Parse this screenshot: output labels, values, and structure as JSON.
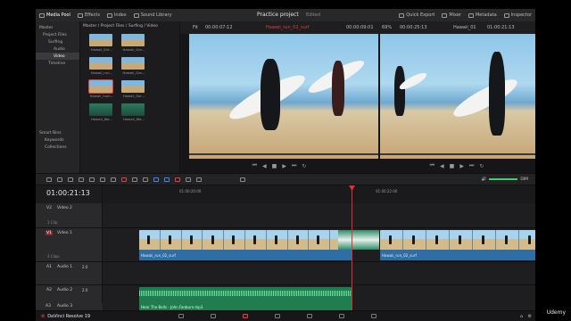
{
  "app": {
    "project_title": "Practice project",
    "project_status": "Edited",
    "brand": "DaVinci Resolve 19"
  },
  "topbar": {
    "left_items": [
      {
        "label": "Media Pool",
        "icon": "media-pool-icon",
        "active": true
      },
      {
        "label": "Effects",
        "icon": "effects-icon",
        "active": false
      },
      {
        "label": "Index",
        "icon": "index-icon",
        "active": false
      },
      {
        "label": "Sound Library",
        "icon": "sound-library-icon",
        "active": false
      }
    ],
    "right_items": [
      {
        "label": "Quick Export",
        "icon": "quick-export-icon"
      },
      {
        "label": "Mixer",
        "icon": "mixer-icon"
      },
      {
        "label": "Metadata",
        "icon": "metadata-icon"
      },
      {
        "label": "Inspector",
        "icon": "inspector-icon"
      }
    ]
  },
  "media_pool": {
    "tree": [
      {
        "label": "Master",
        "selected": false
      },
      {
        "label": "Project Files",
        "selected": false
      },
      {
        "label": "Surfing",
        "selected": false
      },
      {
        "label": "Audio",
        "selected": false
      },
      {
        "label": "Video",
        "selected": true
      },
      {
        "label": "Timeline",
        "selected": false
      }
    ],
    "smart_bins_title": "Smart Bins",
    "smart_bins": [
      "Keywords",
      "Collections"
    ],
    "path": "Master / Project Files / Surfing / Video",
    "clips": [
      "Hawaii_Ent...",
      "Hawaii_Gre...",
      "Hawaii_run...",
      "Hawaii_Gre...",
      "Hawaii_hum...",
      "Hawaii_Sur...",
      "Hawaii_Wa...",
      "Hawaii_Wa..."
    ]
  },
  "source_viewer": {
    "zoom": "Fit",
    "timecode_left": "00:00:07:12",
    "clip_name": "Hawaii_run_02_surf",
    "timecode_right": "00:00:09:01"
  },
  "timeline_viewer": {
    "zoom": "69%",
    "timecode_left": "00:00:25:13",
    "timeline_name": "Hawaii_01",
    "timecode_right": "01:00:21:13"
  },
  "timeline": {
    "current_timecode": "01:00:21:13",
    "ruler_labels": [
      "01:00:20:00",
      "01:00:22:00"
    ],
    "volume_label": "DIM",
    "tracks": [
      {
        "id": "V2",
        "name": "Video 2",
        "sub": "1 Clip"
      },
      {
        "id": "V1",
        "name": "Video 1",
        "sub": "3 Clips"
      },
      {
        "id": "A1",
        "name": "Audio 1",
        "level": "2.0"
      },
      {
        "id": "A2",
        "name": "Audio 2",
        "level": "2.0",
        "sub": "1 Clip"
      },
      {
        "id": "A3",
        "name": "Audio 3"
      }
    ],
    "video_clips": [
      {
        "label": "Hawaii_run_02_surf"
      },
      {
        "label": "Hawaii_run_02_surf"
      }
    ],
    "audio_clip_label": "Hear The Bells - John Fanburn.mp3"
  },
  "watermark": "Udemy",
  "colors": {
    "accent_red": "#e04040",
    "video_clip": "#2e6ea5",
    "audio_clip": "#1f7d4e",
    "accent_blue": "#3c8fe6"
  }
}
